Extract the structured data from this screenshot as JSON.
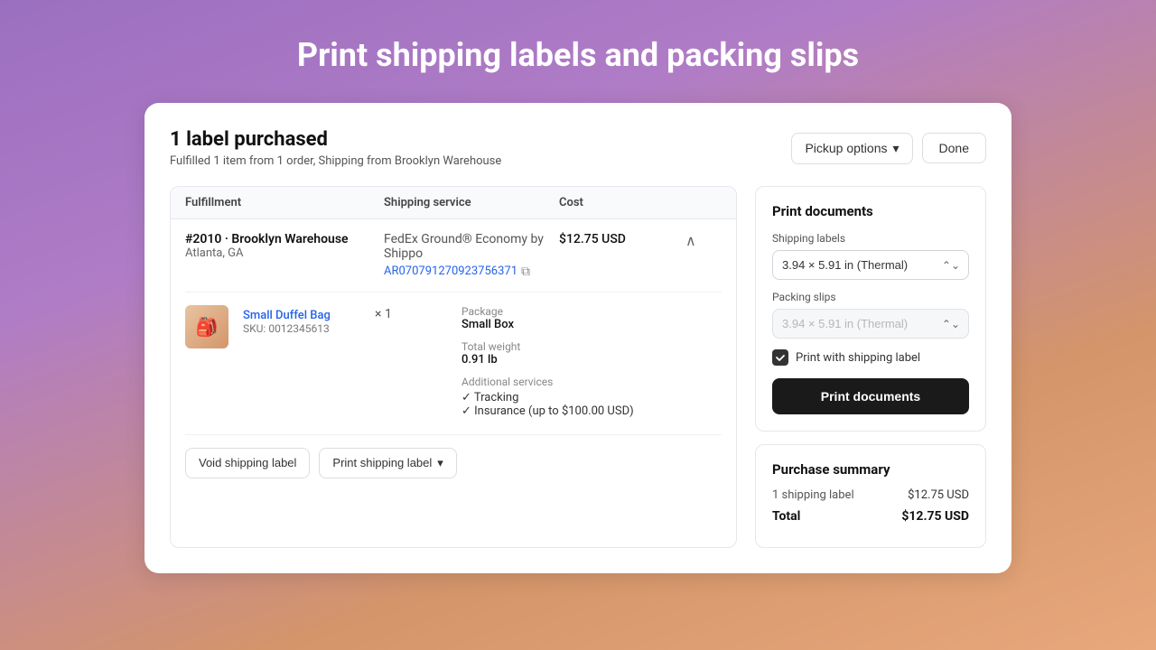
{
  "page": {
    "title": "Print shipping labels and packing slips"
  },
  "header": {
    "label_count": "1 label purchased",
    "subtitle": "Fulfilled 1 item from 1 order, Shipping from Brooklyn Warehouse",
    "pickup_options_label": "Pickup options",
    "done_label": "Done"
  },
  "table": {
    "columns": {
      "fulfillment": "Fulfillment",
      "shipping_service": "Shipping service",
      "cost": "Cost"
    },
    "row": {
      "warehouse_name": "#2010 · Brooklyn Warehouse",
      "location": "Atlanta, GA",
      "carrier": "FedEx Ground® Economy",
      "carrier_suffix": "by Shippo",
      "tracking_number": "AR070791270923756371",
      "cost": "$12.75 USD",
      "item": {
        "name": "Small Duffel Bag",
        "sku": "SKU: 0012345613",
        "qty": "× 1",
        "package_label": "Package",
        "package_value": "Small Box",
        "weight_label": "Total weight",
        "weight_value": "0.91 lb",
        "additional_label": "Additional services",
        "services": [
          "✓ Tracking",
          "✓ Insurance (up to $100.00 USD)"
        ]
      }
    }
  },
  "action_buttons": {
    "void_label": "Void shipping label",
    "print_label": "Print shipping label"
  },
  "print_documents": {
    "title": "Print documents",
    "shipping_labels_label": "Shipping labels",
    "shipping_labels_value": "3.94 × 5.91 in (Thermal)",
    "packing_slips_label": "Packing slips",
    "packing_slips_value": "3.94 × 5.91 in (Thermal)",
    "checkbox_label": "Print with shipping label",
    "print_button_label": "Print documents"
  },
  "purchase_summary": {
    "title": "Purchase summary",
    "row1_label": "1 shipping label",
    "row1_value": "$12.75 USD",
    "total_label": "Total",
    "total_value": "$12.75 USD"
  }
}
